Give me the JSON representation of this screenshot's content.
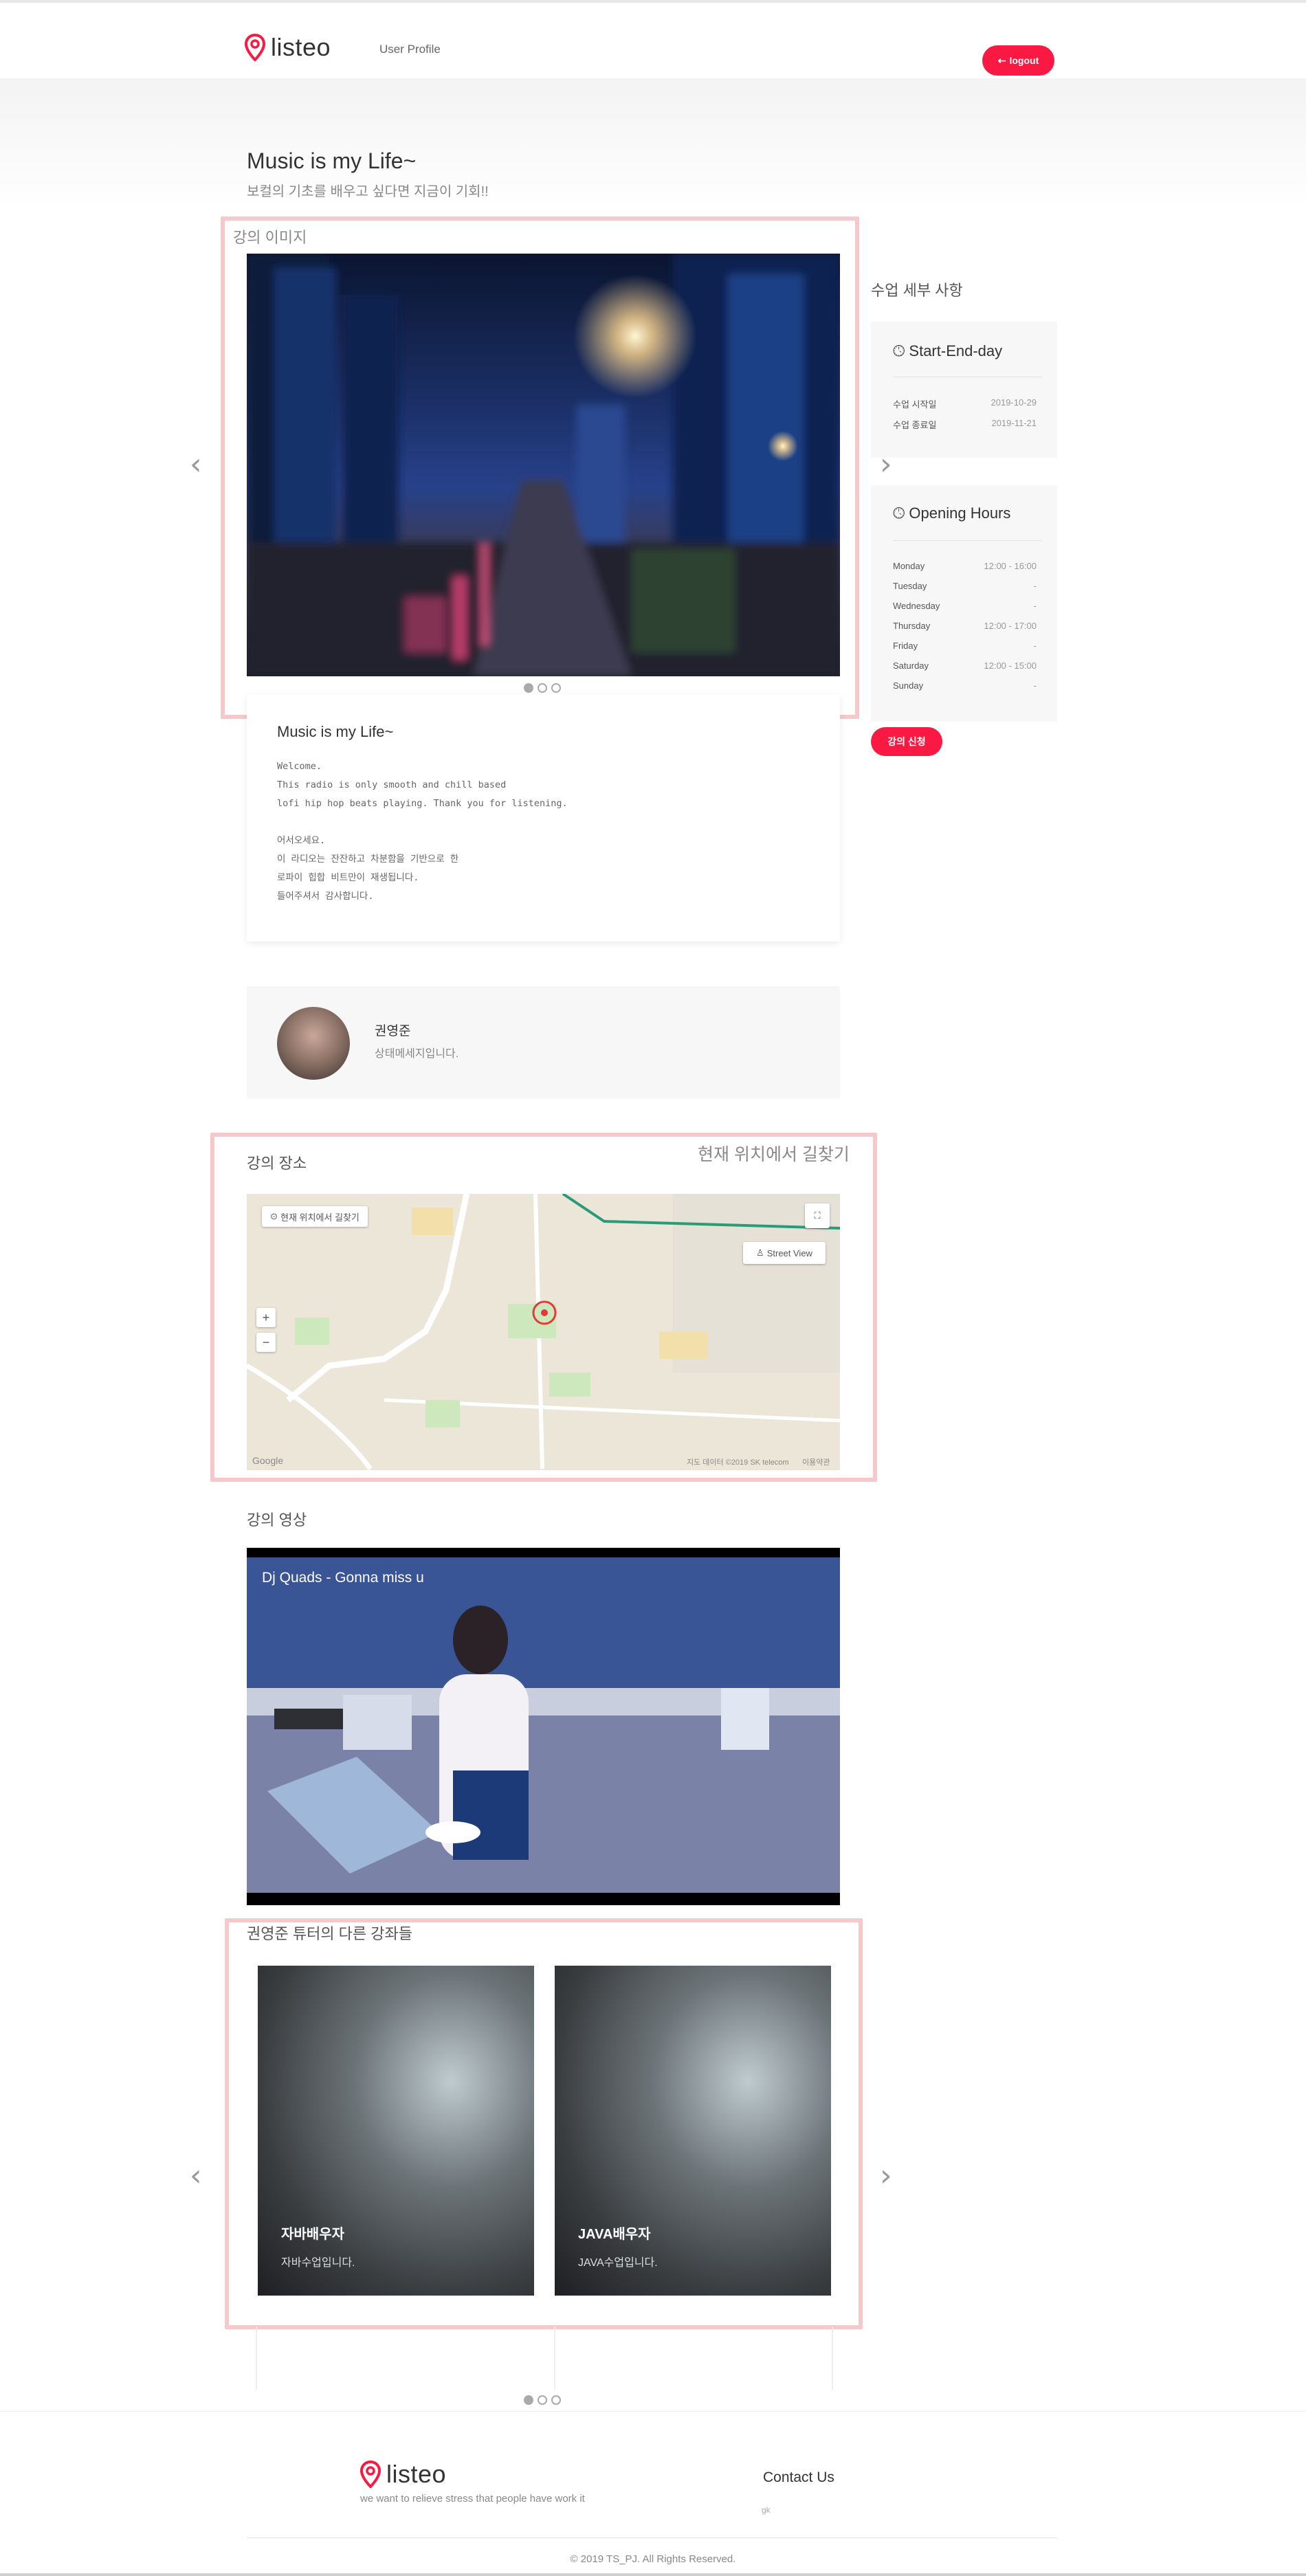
{
  "header": {
    "logo_text": "listeo",
    "nav_user_profile": "User Profile",
    "logout_label": "logout",
    "brand_color": "#f91942"
  },
  "course": {
    "title": "Music is my Life~",
    "subtitle": "보컬의 기초를 배우고 싶다면 지금이 기회!!",
    "image_section_label": "강의 이미지",
    "desc_title": "Music is my Life~",
    "desc_body": "Welcome.\nThis radio is only smooth and chill based\nlofi hip hop beats playing. Thank you for listening.\n\n어서오세요.\n이 라디오는 잔잔하고 차분함을 기반으로 한\n로파이 힙합 비트만이 재생됩니다.\n들어주셔서 감사합니다."
  },
  "slider": {
    "active_index": 0,
    "count": 3
  },
  "tutor": {
    "name": "권영준",
    "status": "상태메세지입니다."
  },
  "location": {
    "label": "강의 장소",
    "directions_link": "현재 위치에서 길찾기",
    "map_my_location": "현재 위치에서 길찾기",
    "map_street_view": "Street View",
    "map_zoom_in": "+",
    "map_zoom_out": "−",
    "map_copyright": "지도 데이터 ©2019 SK telecom",
    "map_terms": "이용약관",
    "map_logo": "Google"
  },
  "video": {
    "label": "강의 영상",
    "title": "Dj Quads - Gonna miss u"
  },
  "other_courses": {
    "label": "권영준 튜터의 다른 강좌들",
    "items": [
      {
        "name": "자바배우자",
        "desc": "자바수업입니다."
      },
      {
        "name": "JAVA배우자",
        "desc": "JAVA수업입니다."
      }
    ],
    "active_index": 0,
    "count": 3
  },
  "sidebar": {
    "title": "수업 세부 사항",
    "start_end": {
      "heading": "Start-End-day",
      "rows": [
        {
          "k": "수업 시작일",
          "v": "2019-10-29"
        },
        {
          "k": "수업 종료일",
          "v": "2019-11-21"
        }
      ]
    },
    "hours": {
      "heading": "Opening Hours",
      "rows": [
        {
          "k": "Monday",
          "v": "12:00 - 16:00"
        },
        {
          "k": "Tuesday",
          "v": "-"
        },
        {
          "k": "Wednesday",
          "v": "-"
        },
        {
          "k": "Thursday",
          "v": "12:00 - 17:00"
        },
        {
          "k": "Friday",
          "v": "-"
        },
        {
          "k": "Saturday",
          "v": "12:00 - 15:00"
        },
        {
          "k": "Sunday",
          "v": "-"
        }
      ]
    },
    "apply_label": "강의 신청"
  },
  "footer": {
    "logo_text": "listeo",
    "tagline": "we want to relieve stress that people have work it",
    "contact_heading": "Contact Us",
    "contact_sub": "gk",
    "copyright": "© 2019 TS_PJ. All Rights Reserved."
  }
}
